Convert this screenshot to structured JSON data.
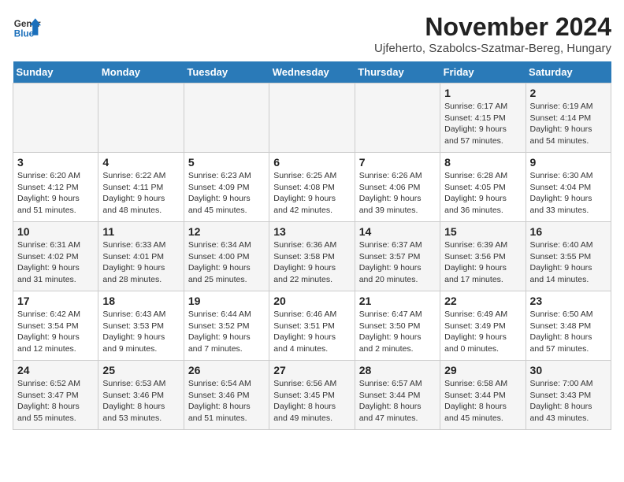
{
  "logo": {
    "text_general": "General",
    "text_blue": "Blue"
  },
  "header": {
    "month_year": "November 2024",
    "location": "Ujfeherto, Szabolcs-Szatmar-Bereg, Hungary"
  },
  "weekdays": [
    "Sunday",
    "Monday",
    "Tuesday",
    "Wednesday",
    "Thursday",
    "Friday",
    "Saturday"
  ],
  "weeks": [
    [
      {
        "day": "",
        "info": ""
      },
      {
        "day": "",
        "info": ""
      },
      {
        "day": "",
        "info": ""
      },
      {
        "day": "",
        "info": ""
      },
      {
        "day": "",
        "info": ""
      },
      {
        "day": "1",
        "info": "Sunrise: 6:17 AM\nSunset: 4:15 PM\nDaylight: 9 hours and 57 minutes."
      },
      {
        "day": "2",
        "info": "Sunrise: 6:19 AM\nSunset: 4:14 PM\nDaylight: 9 hours and 54 minutes."
      }
    ],
    [
      {
        "day": "3",
        "info": "Sunrise: 6:20 AM\nSunset: 4:12 PM\nDaylight: 9 hours and 51 minutes."
      },
      {
        "day": "4",
        "info": "Sunrise: 6:22 AM\nSunset: 4:11 PM\nDaylight: 9 hours and 48 minutes."
      },
      {
        "day": "5",
        "info": "Sunrise: 6:23 AM\nSunset: 4:09 PM\nDaylight: 9 hours and 45 minutes."
      },
      {
        "day": "6",
        "info": "Sunrise: 6:25 AM\nSunset: 4:08 PM\nDaylight: 9 hours and 42 minutes."
      },
      {
        "day": "7",
        "info": "Sunrise: 6:26 AM\nSunset: 4:06 PM\nDaylight: 9 hours and 39 minutes."
      },
      {
        "day": "8",
        "info": "Sunrise: 6:28 AM\nSunset: 4:05 PM\nDaylight: 9 hours and 36 minutes."
      },
      {
        "day": "9",
        "info": "Sunrise: 6:30 AM\nSunset: 4:04 PM\nDaylight: 9 hours and 33 minutes."
      }
    ],
    [
      {
        "day": "10",
        "info": "Sunrise: 6:31 AM\nSunset: 4:02 PM\nDaylight: 9 hours and 31 minutes."
      },
      {
        "day": "11",
        "info": "Sunrise: 6:33 AM\nSunset: 4:01 PM\nDaylight: 9 hours and 28 minutes."
      },
      {
        "day": "12",
        "info": "Sunrise: 6:34 AM\nSunset: 4:00 PM\nDaylight: 9 hours and 25 minutes."
      },
      {
        "day": "13",
        "info": "Sunrise: 6:36 AM\nSunset: 3:58 PM\nDaylight: 9 hours and 22 minutes."
      },
      {
        "day": "14",
        "info": "Sunrise: 6:37 AM\nSunset: 3:57 PM\nDaylight: 9 hours and 20 minutes."
      },
      {
        "day": "15",
        "info": "Sunrise: 6:39 AM\nSunset: 3:56 PM\nDaylight: 9 hours and 17 minutes."
      },
      {
        "day": "16",
        "info": "Sunrise: 6:40 AM\nSunset: 3:55 PM\nDaylight: 9 hours and 14 minutes."
      }
    ],
    [
      {
        "day": "17",
        "info": "Sunrise: 6:42 AM\nSunset: 3:54 PM\nDaylight: 9 hours and 12 minutes."
      },
      {
        "day": "18",
        "info": "Sunrise: 6:43 AM\nSunset: 3:53 PM\nDaylight: 9 hours and 9 minutes."
      },
      {
        "day": "19",
        "info": "Sunrise: 6:44 AM\nSunset: 3:52 PM\nDaylight: 9 hours and 7 minutes."
      },
      {
        "day": "20",
        "info": "Sunrise: 6:46 AM\nSunset: 3:51 PM\nDaylight: 9 hours and 4 minutes."
      },
      {
        "day": "21",
        "info": "Sunrise: 6:47 AM\nSunset: 3:50 PM\nDaylight: 9 hours and 2 minutes."
      },
      {
        "day": "22",
        "info": "Sunrise: 6:49 AM\nSunset: 3:49 PM\nDaylight: 9 hours and 0 minutes."
      },
      {
        "day": "23",
        "info": "Sunrise: 6:50 AM\nSunset: 3:48 PM\nDaylight: 8 hours and 57 minutes."
      }
    ],
    [
      {
        "day": "24",
        "info": "Sunrise: 6:52 AM\nSunset: 3:47 PM\nDaylight: 8 hours and 55 minutes."
      },
      {
        "day": "25",
        "info": "Sunrise: 6:53 AM\nSunset: 3:46 PM\nDaylight: 8 hours and 53 minutes."
      },
      {
        "day": "26",
        "info": "Sunrise: 6:54 AM\nSunset: 3:46 PM\nDaylight: 8 hours and 51 minutes."
      },
      {
        "day": "27",
        "info": "Sunrise: 6:56 AM\nSunset: 3:45 PM\nDaylight: 8 hours and 49 minutes."
      },
      {
        "day": "28",
        "info": "Sunrise: 6:57 AM\nSunset: 3:44 PM\nDaylight: 8 hours and 47 minutes."
      },
      {
        "day": "29",
        "info": "Sunrise: 6:58 AM\nSunset: 3:44 PM\nDaylight: 8 hours and 45 minutes."
      },
      {
        "day": "30",
        "info": "Sunrise: 7:00 AM\nSunset: 3:43 PM\nDaylight: 8 hours and 43 minutes."
      }
    ]
  ]
}
